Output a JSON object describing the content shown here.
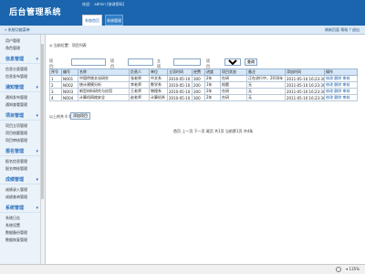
{
  "header": {
    "title": "后台管理系统",
    "userline": "欢迎： admin [修改密码]",
    "tabs": [
      {
        "label": "系统首页",
        "active": true
      },
      {
        "label": "系统管理",
        "active": false
      }
    ]
  },
  "subbar": {
    "side_title": "« 系统功能菜单",
    "right_links": "刷新页面   帮助  ?  退出"
  },
  "sidebar": {
    "items": [
      {
        "type": "item",
        "label": "用户管理"
      },
      {
        "type": "item",
        "label": "角色管理"
      },
      {
        "type": "head",
        "label": "信息管理"
      },
      {
        "type": "item",
        "label": "信息分类管理"
      },
      {
        "type": "item",
        "label": "信息发布管理"
      },
      {
        "type": "head",
        "label": "通知管理"
      },
      {
        "type": "item",
        "label": "通知发布管理"
      },
      {
        "type": "item",
        "label": "通知查看管理"
      },
      {
        "type": "head",
        "label": "项目管理"
      },
      {
        "type": "item",
        "label": "项目立项管理"
      },
      {
        "type": "item",
        "label": "项目结题管理"
      },
      {
        "type": "item",
        "label": "项目审核管理"
      },
      {
        "type": "head",
        "label": "报名管理"
      },
      {
        "type": "item",
        "label": "报名信息管理"
      },
      {
        "type": "item",
        "label": "报名审核管理"
      },
      {
        "type": "head",
        "label": "成绩管理"
      },
      {
        "type": "item",
        "label": "成绩录入管理"
      },
      {
        "type": "item",
        "label": "成绩查询管理"
      },
      {
        "type": "head",
        "label": "系统管理"
      },
      {
        "type": "item",
        "label": "系统日志"
      },
      {
        "type": "item",
        "label": "系统设置"
      },
      {
        "type": "item",
        "label": "数据备份管理"
      },
      {
        "type": "item",
        "label": "数据恢复管理"
      }
    ]
  },
  "main": {
    "caption": "◎ 当前位置：项目列表",
    "filters": {
      "label_code": "项目：总编号",
      "label_name": "项目名称",
      "label_date": "立项时间",
      "label_type": "项目类型",
      "type_selected": "请选",
      "search_button": "查询"
    },
    "table": {
      "columns": [
        "序号",
        "编号",
        "名称",
        "负责人",
        "单位",
        "立项时间",
        "经费",
        "进度",
        "项目状态",
        "备注",
        "添加时间",
        "操作"
      ],
      "rows": [
        [
          "1",
          "NO01",
          "中国传统文化研究",
          "张老师",
          "中文系",
          "2010-05-10",
          "300",
          "2年",
          "在研",
          "正在进行中，2016年",
          "2011-05-10 16:23:30",
          "修改 删除 审核"
        ],
        [
          "2",
          "NO02",
          "统计建模分析",
          "李老师",
          "数学系",
          "2010-05-10",
          "200",
          "1年",
          "结题",
          "无",
          "2011-05-10 16:23:30",
          "修改 删除 审核"
        ],
        [
          "3",
          "NO03",
          "新型材料研究与应用",
          "王老师",
          "物理系",
          "2010-05-10",
          "300",
          "2年",
          "在研",
          "无",
          "2011-05-10 16:23:30",
          "修改 删除 审核"
        ],
        [
          "4",
          "NO04",
          "计算机网络安全",
          "赵老师",
          "计算机系",
          "2010-05-10",
          "300",
          "2年",
          "在研",
          "无",
          "2011-05-10 16:23:30",
          "修改 删除 审核"
        ]
      ]
    },
    "summary_label": "以上的共 4 条",
    "summary_button": "添加项目",
    "pager": "首页  上一页  下一页  尾页  共1页  当前第1页  共4条"
  },
  "statusbar": {
    "zoom": "▾ 135%"
  },
  "colors": {
    "header_blue": "#1a65ad",
    "sidebar_heading": "#2a72bf",
    "table_header": "#d6e7f7"
  }
}
